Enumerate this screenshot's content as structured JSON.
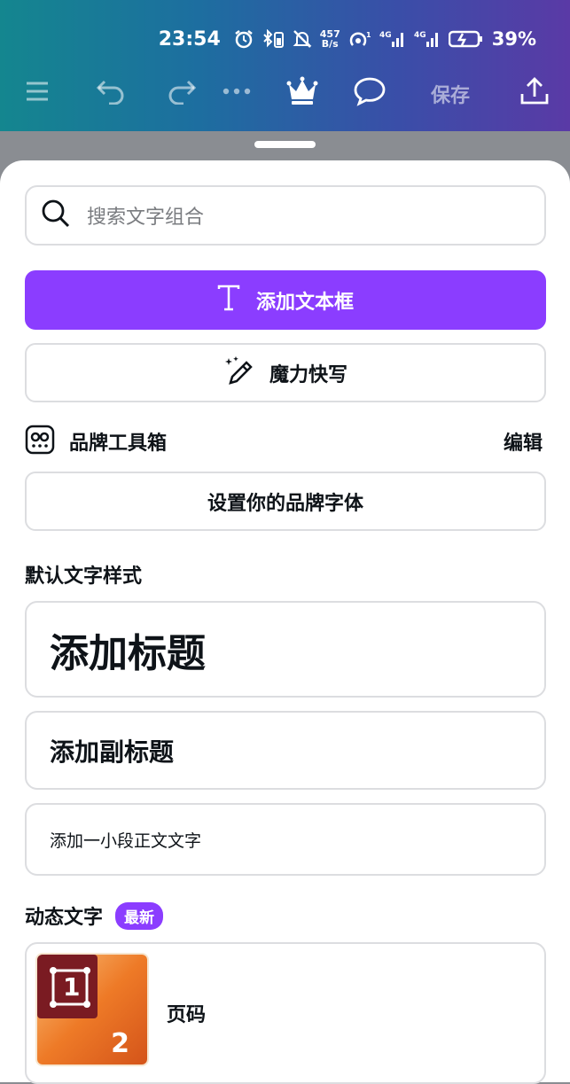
{
  "status_bar": {
    "time": "23:54",
    "net_speed_value": "457",
    "net_speed_unit": "B/s",
    "battery": "39%"
  },
  "toolbar": {
    "save_label": "保存"
  },
  "search": {
    "placeholder": "搜索文字组合"
  },
  "actions": {
    "add_textbox": "添加文本框",
    "magic_write": "魔力快写"
  },
  "brand_kit": {
    "title": "品牌工具箱",
    "edit": "编辑",
    "set_font": "设置你的品牌字体"
  },
  "default_styles": {
    "section_title": "默认文字样式",
    "heading": "添加标题",
    "subheading": "添加副标题",
    "body": "添加一小段正文文字"
  },
  "dynamic_text": {
    "section_title": "动态文字",
    "badge": "最新",
    "page_number_label": "页码",
    "thumb_number_1": "1",
    "thumb_number_2": "2"
  },
  "colors": {
    "accent": "#8b3dff",
    "text": "#0e1318",
    "border": "#dcdde0"
  }
}
